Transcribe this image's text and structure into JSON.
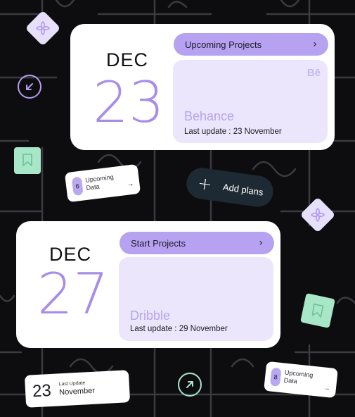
{
  "card1": {
    "month": "DEC",
    "day": "23",
    "action_label": "Upcoming Projects",
    "chevron": "›",
    "project_name": "Behance",
    "last_update": "Last update : 23 November",
    "brand_mark": "Bē"
  },
  "card2": {
    "month": "DEC",
    "day": "27",
    "action_label": "Start Projects",
    "chevron": "›",
    "project_name": "Dribble",
    "last_update": "Last update : 29 November"
  },
  "mini1": {
    "count": "6",
    "label_line1": "Upcoming",
    "label_line2": "Data",
    "arrow": "→"
  },
  "mini2": {
    "count": "8",
    "label_line1": "Upcoming",
    "label_line2": "Data",
    "arrow": "→"
  },
  "mini3": {
    "day": "23",
    "label_small": "Last Update",
    "label_month": "November"
  },
  "add_plans": {
    "plus": "+",
    "label": "Add plans"
  },
  "colors": {
    "accent": "#b6a2f0",
    "panel": "#ece6fc",
    "mint": "#a8e6c8",
    "dark_button": "#1d2a33"
  }
}
